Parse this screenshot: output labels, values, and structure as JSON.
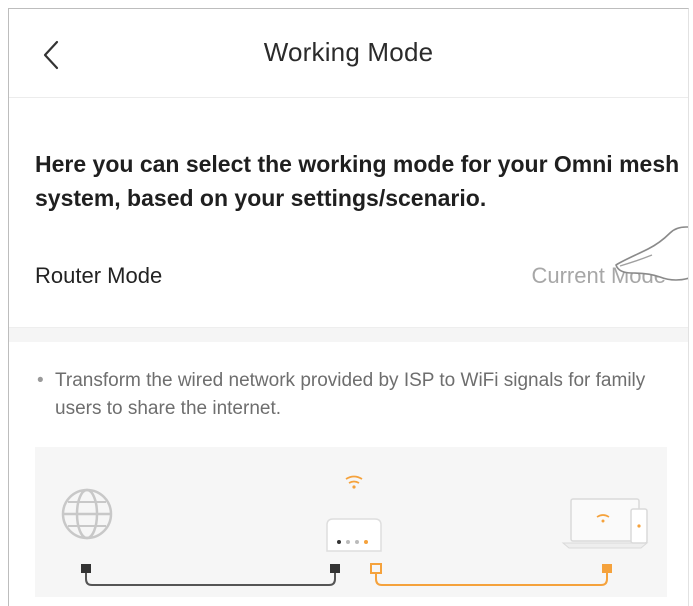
{
  "header": {
    "title": "Working Mode"
  },
  "intro": {
    "text": "Here you can select the working mode for your Omni mesh system, based on your settings/scenario."
  },
  "mode": {
    "name": "Router Mode",
    "status": "Current Mode"
  },
  "description": {
    "bullet": "•",
    "text": "Transform the wired network provided by ISP to WiFi signals for family users to share the internet."
  },
  "colors": {
    "accent": "#f5a23c",
    "cable": "#555555",
    "panel": "#f6f6f6"
  },
  "icons": [
    "back-arrow-icon",
    "pointing-hand-icon",
    "globe-icon",
    "router-icon",
    "wifi-icon",
    "laptop-icon",
    "phone-icon"
  ]
}
